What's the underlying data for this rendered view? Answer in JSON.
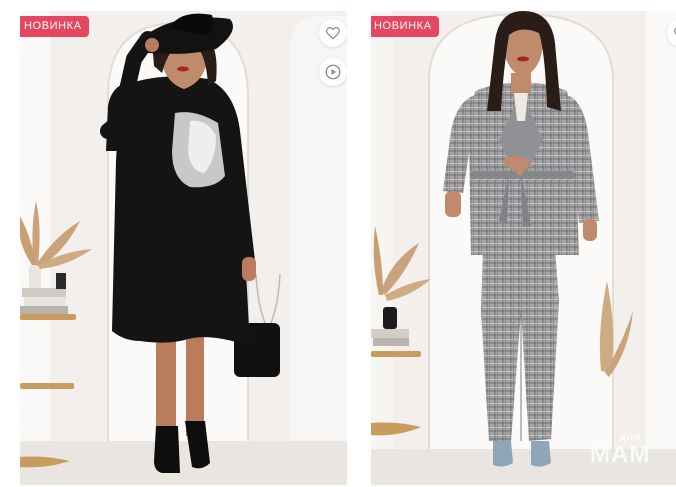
{
  "products": [
    {
      "badge": "НОВИНКА",
      "icons": [
        "heart-icon",
        "play-icon"
      ],
      "colors": {
        "badge_bg": "#e4475f",
        "garment": "#141414"
      }
    },
    {
      "badge": "НОВИНКА",
      "icons": [
        "heart-icon"
      ],
      "colors": {
        "badge_bg": "#e4475f",
        "garment": "#9a9ca0"
      }
    }
  ],
  "watermark": {
    "line1": "для",
    "line2": "МАМ"
  }
}
